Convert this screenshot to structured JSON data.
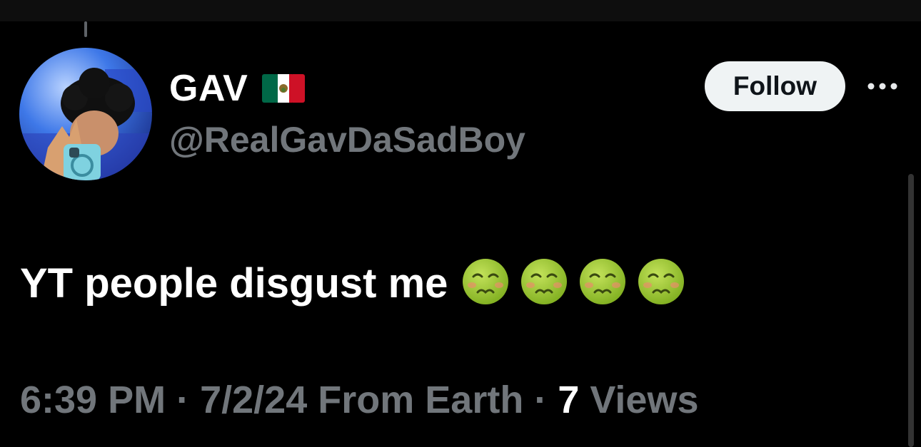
{
  "tweet": {
    "author": {
      "display_name": "GAV",
      "flag_icon": "mexico-flag-icon",
      "handle": "@RealGavDaSadBoy"
    },
    "follow_label": "Follow",
    "more_icon": "more-horizontal-icon",
    "text": "YT people disgust me",
    "emoji_icon": "nauseated-face-icon",
    "emoji_count": 4,
    "meta": {
      "time": "6:39 PM",
      "separator": "·",
      "date": "7/2/24",
      "location": "From Earth",
      "views_count": "7",
      "views_label": "Views"
    }
  },
  "colors": {
    "background": "#000000",
    "primary_text": "#ffffff",
    "secondary_text": "#71767b",
    "follow_bg": "#eff3f4"
  }
}
